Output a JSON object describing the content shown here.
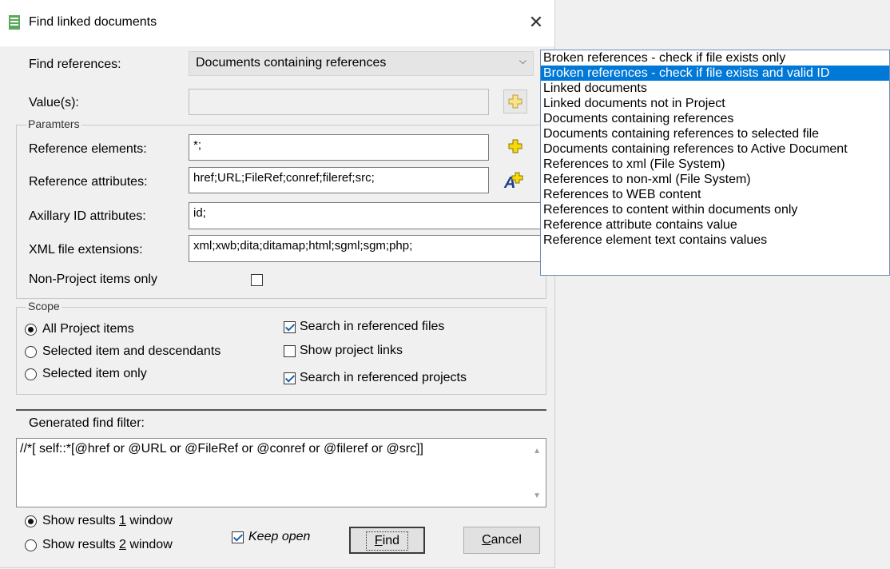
{
  "dialog": {
    "title": "Find linked documents",
    "close_glyph": "✕"
  },
  "find_references": {
    "label": "Find references:",
    "selected": "Documents containing references",
    "arrow": "⌵"
  },
  "values": {
    "label": "Value(s):",
    "value": ""
  },
  "params": {
    "legend": "Paramters",
    "ref_elements_label": "Reference elements:",
    "ref_elements_value": "*;",
    "ref_attrs_label": "Reference attributes:",
    "ref_attrs_value": "href;URL;FileRef;conref;fileref;src;",
    "aux_id_label": "Axillary ID attributes:",
    "aux_id_value": "id;",
    "xml_ext_label": "XML file extensions:",
    "xml_ext_value": "xml;xwb;dita;ditamap;html;sgml;sgm;php;",
    "non_project_label": "Non-Project items only"
  },
  "scope": {
    "legend": "Scope",
    "radio_all": "All Project items",
    "radio_selected_desc": "Selected item and descendants",
    "radio_selected_only": "Selected item only",
    "search_referenced_files": "Search in referenced files",
    "show_project_links": "Show project links",
    "search_referenced_projects": "Search in referenced projects"
  },
  "filter": {
    "label": "Generated find filter:",
    "value": "//*[ self::*[@href or @URL or @FileRef or @conref or @fileref or @src]]"
  },
  "footer": {
    "show1_pre": "Show results ",
    "show1_key": "1",
    "show1_post": " window",
    "show2_pre": "Show results ",
    "show2_key": "2",
    "show2_post": " window",
    "keep_open": "Keep open",
    "find_key": "F",
    "find_rest": "ind",
    "cancel_key": "C",
    "cancel_rest": "ancel"
  },
  "dropdown_items": [
    "Broken references - check if file exists only",
    "Broken references - check if file exists and valid ID",
    "Linked documents",
    "Linked documents not in Project",
    "Documents containing references",
    "Documents containing references to selected file",
    "Documents containing references to Active Document",
    "References to xml (File System)",
    "References to non-xml (File System)",
    "References to WEB content",
    "References to content within documents only",
    "Reference attribute contains value",
    "Reference element text contains values"
  ],
  "dropdown_selected_index": 1,
  "icons": {
    "title": "document-list-icon",
    "add": "plus-icon",
    "add_attr": "add-attribute-icon"
  },
  "colors": {
    "accent": "#0078d7",
    "plus_yellow": "#f5d90a"
  }
}
